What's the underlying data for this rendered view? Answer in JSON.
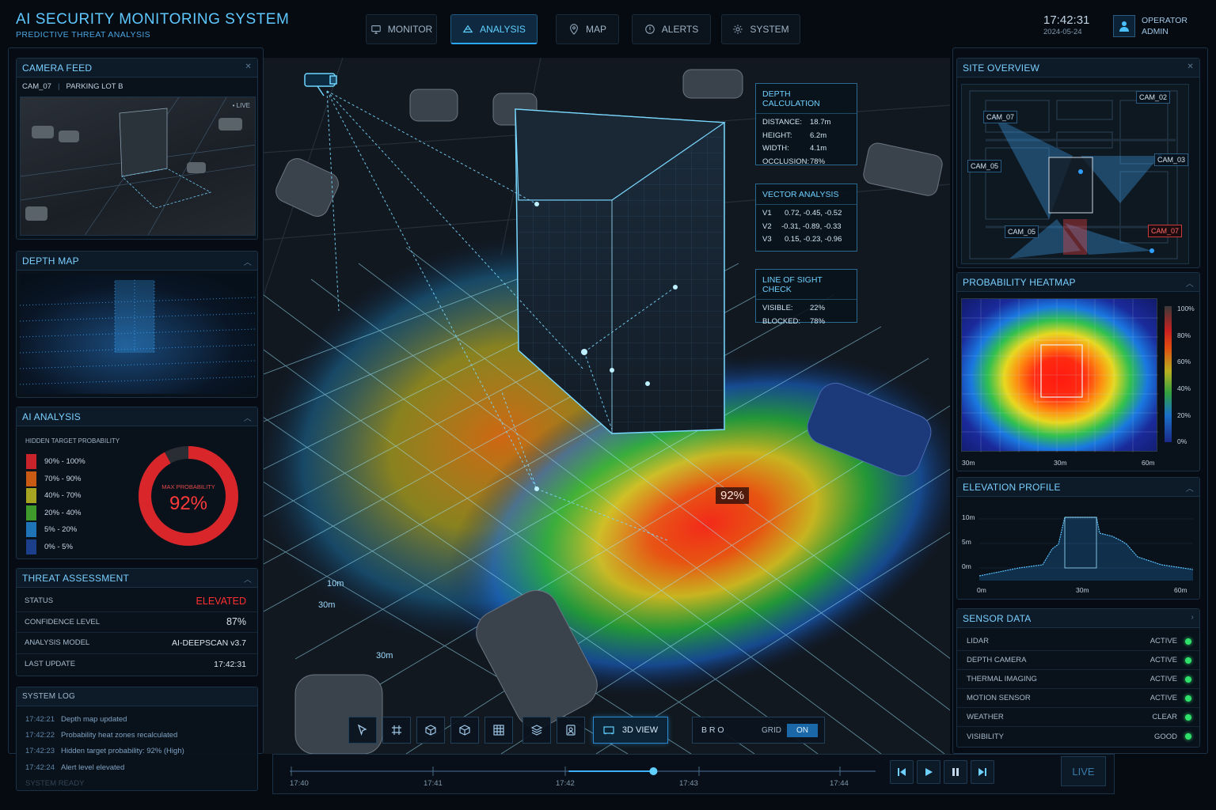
{
  "app": {
    "title": "AI SECURITY MONITORING SYSTEM",
    "subtitle": "PREDICTIVE THREAT ANALYSIS"
  },
  "nav": [
    {
      "label": "MONITOR",
      "icon": "monitor-icon"
    },
    {
      "label": "ANALYSIS",
      "icon": "radar-icon",
      "active": true
    },
    {
      "label": "MAP",
      "icon": "map-pin-icon"
    },
    {
      "label": "ALERTS",
      "icon": "alert-icon"
    },
    {
      "label": "SYSTEM",
      "icon": "gear-icon"
    }
  ],
  "header": {
    "time": "17:42:31",
    "date": "2024-05-24",
    "user_role": "OPERATOR",
    "user_name": "ADMIN"
  },
  "camera_feed": {
    "title": "CAMERA FEED",
    "cam": "CAM_07",
    "location": "PARKING LOT B",
    "live": "• LIVE"
  },
  "depth_map": {
    "title": "DEPTH MAP"
  },
  "ai_analysis": {
    "title": "AI ANALYSIS",
    "legend_title": "HIDDEN TARGET PROBABILITY",
    "legend": [
      {
        "label": "90% - 100%",
        "color": "#c8222a"
      },
      {
        "label": "70% - 90%",
        "color": "#c85a14"
      },
      {
        "label": "40% - 70%",
        "color": "#a6a420"
      },
      {
        "label": "20% - 40%",
        "color": "#3e9a2a"
      },
      {
        "label": "5% - 20%",
        "color": "#1f74b8"
      },
      {
        "label": "0% - 5%",
        "color": "#1c3f8c"
      }
    ],
    "gauge_label": "MAX PROBABILITY",
    "gauge_value": "92%",
    "gauge_fraction": 0.92
  },
  "threat": {
    "title": "THREAT ASSESSMENT",
    "rows": [
      {
        "k": "STATUS",
        "v": "ELEVATED"
      },
      {
        "k": "CONFIDENCE LEVEL",
        "v": "87%"
      },
      {
        "k": "ANALYSIS MODEL",
        "v": "AI-DEEPSCAN v3.7"
      },
      {
        "k": "LAST UPDATE",
        "v": "17:42:31"
      }
    ]
  },
  "log": {
    "title": "SYSTEM LOG",
    "entries": [
      {
        "t": "17:42:21",
        "m": "Depth map updated"
      },
      {
        "t": "17:42:22",
        "m": "Probability heat zones recalculated"
      },
      {
        "t": "17:42:23",
        "m": "Hidden target probability: 92% (High)"
      },
      {
        "t": "17:42:24",
        "m": "Alert level elevated"
      },
      {
        "t": "",
        "m": "SYSTEM READY"
      }
    ]
  },
  "depth_calc": {
    "title": "DEPTH CALCULATION",
    "rows": [
      {
        "k": "DISTANCE:",
        "v": "18.7m"
      },
      {
        "k": "HEIGHT:",
        "v": "6.2m"
      },
      {
        "k": "WIDTH:",
        "v": "4.1m"
      },
      {
        "k": "OCCLUSION:",
        "v": "78%"
      }
    ]
  },
  "vector": {
    "title": "VECTOR ANALYSIS",
    "rows": [
      {
        "k": "V1",
        "v": "0.72, -0.45, -0.52"
      },
      {
        "k": "V2",
        "v": "-0.31, -0.89, -0.33"
      },
      {
        "k": "V3",
        "v": "0.15, -0.23, -0.96"
      }
    ]
  },
  "los": {
    "title": "LINE OF SIGHT CHECK",
    "rows": [
      {
        "k": "VISIBLE:",
        "v": "22%"
      },
      {
        "k": "BLOCKED:",
        "v": "78%"
      }
    ]
  },
  "scene": {
    "prob_label": "92%",
    "dist": [
      "10m",
      "30m",
      "30m"
    ]
  },
  "site": {
    "title": "SITE OVERVIEW",
    "cams": [
      "CAM_02",
      "CAM_07",
      "CAM_05",
      "CAM_03",
      "CAM_05",
      "CAM_07"
    ]
  },
  "heatmap": {
    "title": "PROBABILITY HEATMAP",
    "scale": [
      "100%",
      "80%",
      "60%",
      "40%",
      "20%",
      "0%"
    ],
    "x": [
      "30m",
      "30m",
      "60m"
    ]
  },
  "elevation": {
    "title": "ELEVATION PROFILE",
    "y": [
      "10m",
      "5m",
      "0m"
    ],
    "x": [
      "0m",
      "30m",
      "60m"
    ]
  },
  "sensors": {
    "title": "SENSOR DATA",
    "rows": [
      {
        "k": "LIDAR",
        "v": "ACTIVE"
      },
      {
        "k": "DEPTH CAMERA",
        "v": "ACTIVE"
      },
      {
        "k": "THERMAL IMAGING",
        "v": "ACTIVE"
      },
      {
        "k": "MOTION SENSOR",
        "v": "ACTIVE"
      },
      {
        "k": "WEATHER",
        "v": "CLEAR"
      },
      {
        "k": "VISIBILITY",
        "v": "GOOD"
      }
    ]
  },
  "toolbar": {
    "view_label": "3D VIEW",
    "mode_label": "B R O",
    "grid_label": "GRID",
    "grid_state": "ON",
    "tools": [
      "select-icon",
      "grid-icon",
      "cube-measure-icon",
      "cube-icon",
      "grid-box-icon",
      "layers-icon",
      "camera-user-icon"
    ]
  },
  "timeline": {
    "ticks": [
      "17:40",
      "17:41",
      "17:42",
      "17:43",
      "17:44"
    ],
    "progress": 0.66,
    "live": "LIVE"
  }
}
